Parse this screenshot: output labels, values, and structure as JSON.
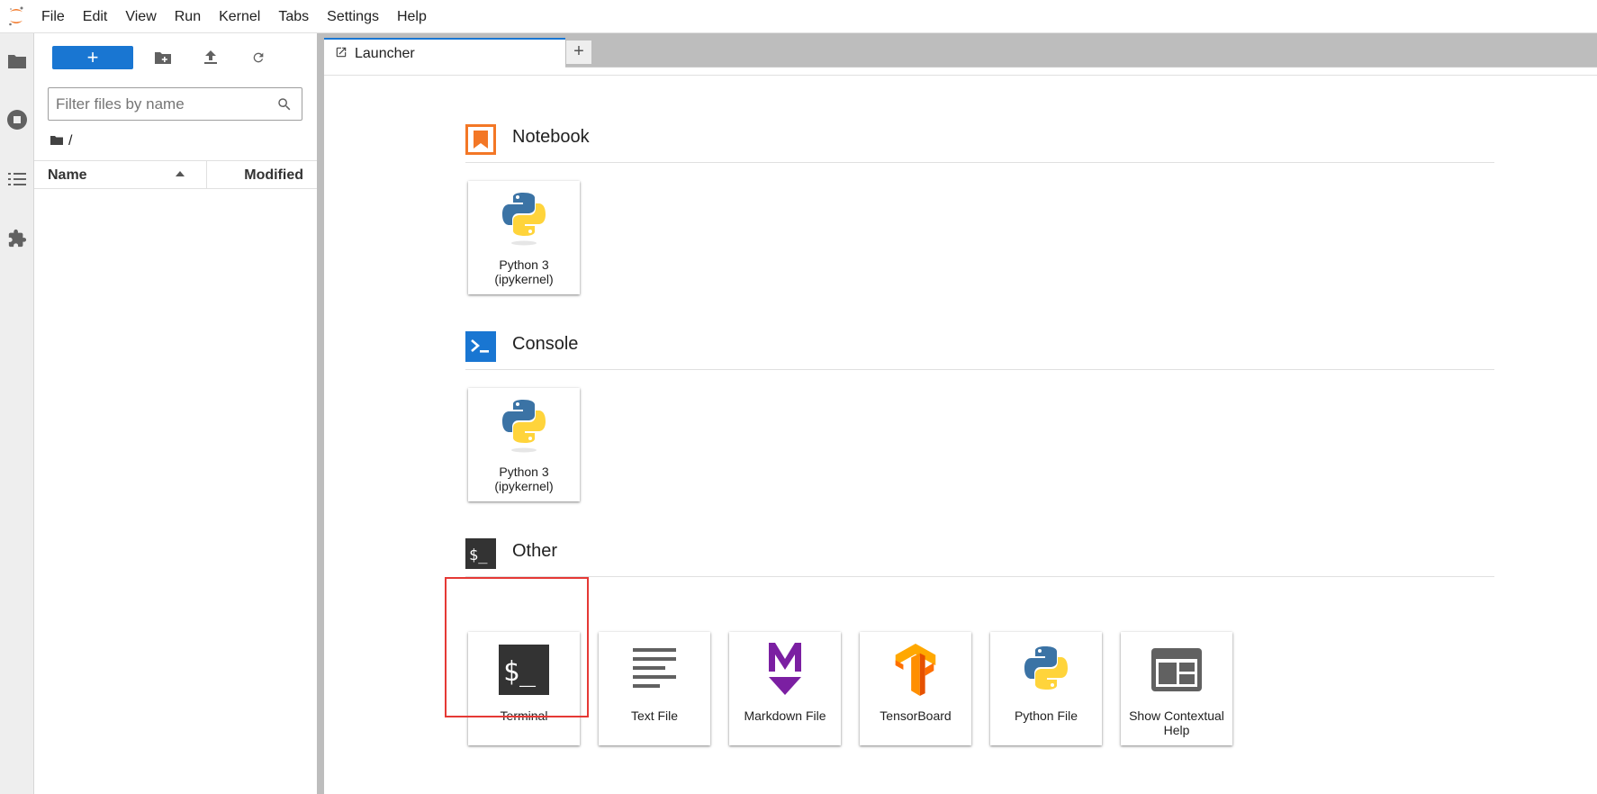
{
  "menubar": {
    "items": [
      "File",
      "Edit",
      "View",
      "Run",
      "Kernel",
      "Tabs",
      "Settings",
      "Help"
    ]
  },
  "activity_bar": {
    "icons": [
      "folder-icon",
      "running-icon",
      "toc-icon",
      "extension-icon"
    ]
  },
  "file_browser": {
    "new_button_label": "+",
    "filter_placeholder": "Filter files by name",
    "filter_value": "",
    "breadcrumb_path": "/",
    "columns": {
      "name": "Name",
      "modified": "Modified"
    }
  },
  "tabs": [
    {
      "label": "Launcher",
      "active": true
    }
  ],
  "add_tab_label": "+",
  "launcher": {
    "sections": [
      {
        "title": "Notebook",
        "cards": [
          {
            "label": "Python 3 (ipykernel)",
            "icon": "python-icon"
          }
        ]
      },
      {
        "title": "Console",
        "cards": [
          {
            "label": "Python 3 (ipykernel)",
            "icon": "python-icon"
          }
        ]
      },
      {
        "title": "Other",
        "cards": [
          {
            "label": "Terminal",
            "icon": "terminal-icon"
          },
          {
            "label": "Text File",
            "icon": "text-file-icon"
          },
          {
            "label": "Markdown File",
            "icon": "markdown-icon"
          },
          {
            "label": "TensorBoard",
            "icon": "tensorboard-icon"
          },
          {
            "label": "Python File",
            "icon": "python-icon"
          },
          {
            "label": "Show Contextual Help",
            "icon": "contextual-help-icon"
          }
        ]
      }
    ]
  },
  "colors": {
    "brand_blue": "#1976d2",
    "notebook_orange": "#f37726",
    "highlight_red": "#e53935",
    "python_blue": "#3b73a5",
    "python_yellow": "#ffd43b",
    "markdown_purple": "#7b1fa2",
    "tensorflow_orange": "#ff8f00"
  }
}
